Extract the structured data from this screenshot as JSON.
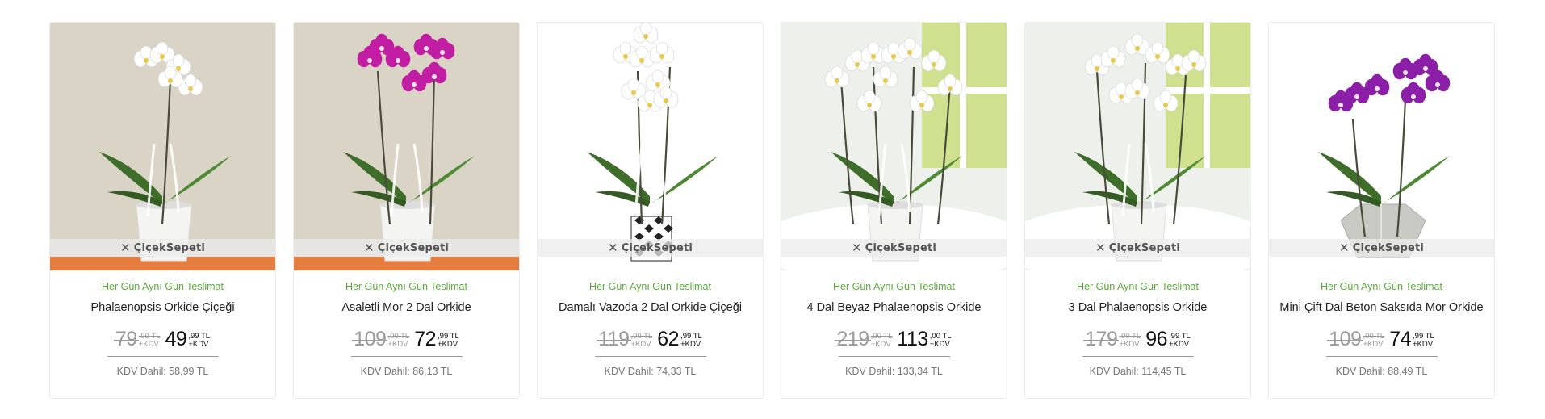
{
  "brand_watermark": "ÇiçekSepeti",
  "products": [
    {
      "delivery": "Her Gün Aynı Gün Teslimat",
      "name": "Phalaenopsis Orkide Çiçeği",
      "old_price_main": "79",
      "old_price_cents": ",99 TL",
      "old_price_tax": "+KDV",
      "new_price_main": "49",
      "new_price_cents": ",99 TL",
      "new_price_tax": "+KDV",
      "kdv_included": "KDV Dahil: 58,99 TL",
      "flower_color": "#ffffff",
      "pot": "white",
      "background": "beige"
    },
    {
      "delivery": "Her Gün Aynı Gün Teslimat",
      "name": "Asaletli Mor 2 Dal Orkide",
      "old_price_main": "109",
      "old_price_cents": ",00 TL",
      "old_price_tax": "+KDV",
      "new_price_main": "72",
      "new_price_cents": ",99 TL",
      "new_price_tax": "+KDV",
      "kdv_included": "KDV Dahil: 86,13 TL",
      "flower_color": "#c21ea3",
      "pot": "white",
      "background": "beige"
    },
    {
      "delivery": "Her Gün Aynı Gün Teslimat",
      "name": "Damalı Vazoda 2 Dal Orkide Çiçeği",
      "old_price_main": "119",
      "old_price_cents": ",00 TL",
      "old_price_tax": "+KDV",
      "new_price_main": "62",
      "new_price_cents": ",99 TL",
      "new_price_tax": "+KDV",
      "kdv_included": "KDV Dahil: 74,33 TL",
      "flower_color": "#ffffff",
      "pot": "checkered",
      "background": "white"
    },
    {
      "delivery": "Her Gün Aynı Gün Teslimat",
      "name": "4 Dal Beyaz Phalaenopsis Orkide",
      "old_price_main": "219",
      "old_price_cents": ",00 TL",
      "old_price_tax": "+KDV",
      "new_price_main": "113",
      "new_price_cents": ",00 TL",
      "new_price_tax": "+KDV",
      "kdv_included": "KDV Dahil: 133,34 TL",
      "flower_color": "#ffffff",
      "pot": "white",
      "background": "window"
    },
    {
      "delivery": "Her Gün Aynı Gün Teslimat",
      "name": "3 Dal Phalaenopsis Orkide",
      "old_price_main": "179",
      "old_price_cents": ",00 TL",
      "old_price_tax": "+KDV",
      "new_price_main": "96",
      "new_price_cents": ",99 TL",
      "new_price_tax": "+KDV",
      "kdv_included": "KDV Dahil: 114,45 TL",
      "flower_color": "#ffffff",
      "pot": "white",
      "background": "window"
    },
    {
      "delivery": "Her Gün Aynı Gün Teslimat",
      "name": "Mini Çift Dal Beton Saksıda Mor Orkide",
      "old_price_main": "109",
      "old_price_cents": ",00 TL",
      "old_price_tax": "+KDV",
      "new_price_main": "74",
      "new_price_cents": ",99 TL",
      "new_price_tax": "+KDV",
      "kdv_included": "KDV Dahil: 88,49 TL",
      "flower_color": "#8b1fa8",
      "pot": "concrete",
      "background": "white"
    }
  ]
}
